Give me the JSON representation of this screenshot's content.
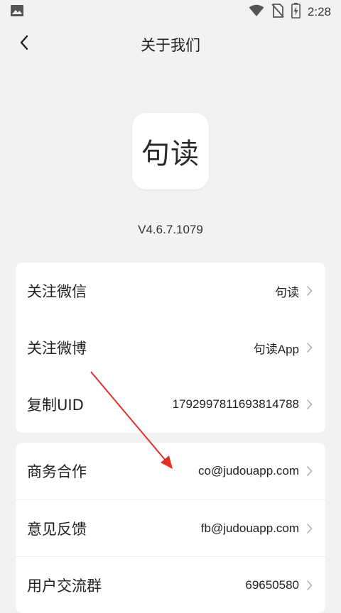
{
  "status_bar": {
    "time": "2:28",
    "icons": [
      "image-icon",
      "wifi-icon",
      "no-sim-icon",
      "battery-charging-icon"
    ]
  },
  "header": {
    "title": "关于我们",
    "back_icon": "chevron-left-icon"
  },
  "logo": {
    "text": "句读"
  },
  "version": "V4.6.7.1079",
  "card1": {
    "rows": [
      {
        "label": "关注微信",
        "value": "句读"
      },
      {
        "label": "关注微博",
        "value": "句读App"
      },
      {
        "label": "复制UID",
        "value": "1792997811693814788"
      }
    ]
  },
  "card2": {
    "rows": [
      {
        "label": "商务合作",
        "value": "co@judouapp.com"
      },
      {
        "label": "意见反馈",
        "value": "fb@judouapp.com"
      },
      {
        "label": "用户交流群",
        "value": "69650580"
      }
    ]
  },
  "colors": {
    "background": "#f2f2f2",
    "card": "#ffffff",
    "text": "#222222",
    "chevron": "#b0b0b0",
    "annotation_arrow": "#e0302a"
  }
}
